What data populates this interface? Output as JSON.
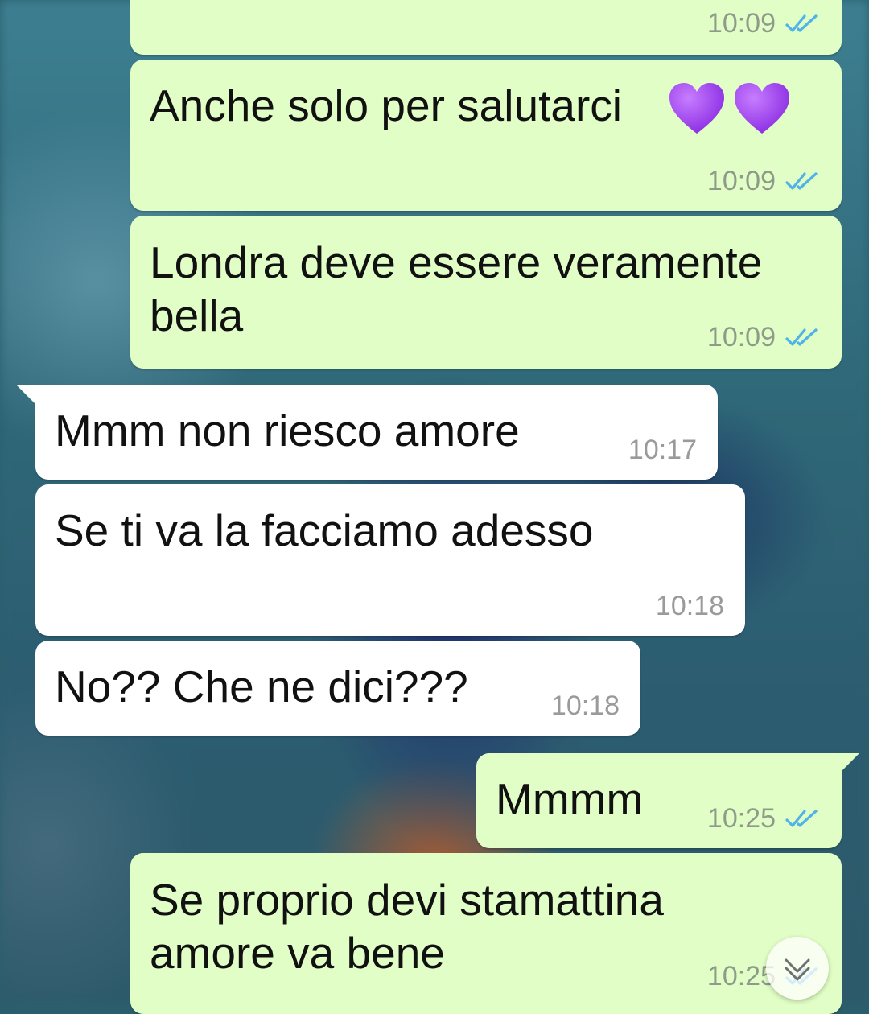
{
  "colors": {
    "outgoing_bubble": "#e1fec6",
    "incoming_bubble": "#ffffff",
    "read_ticks": "#4fb3e8",
    "timestamp": "#8f9a8a"
  },
  "messages": [
    {
      "direction": "outgoing",
      "text": "",
      "time": "10:09",
      "status_icon": "double-check-read-icon"
    },
    {
      "direction": "outgoing",
      "text": "Anche solo per salutarci",
      "emoji": [
        "purple-heart-icon",
        "purple-heart-icon"
      ],
      "time": "10:09",
      "status_icon": "double-check-read-icon"
    },
    {
      "direction": "outgoing",
      "text_line1": "Londra deve essere veramente",
      "text_line2": "bella",
      "time": "10:09",
      "status_icon": "double-check-read-icon"
    },
    {
      "direction": "incoming",
      "text": "Mmm non riesco amore",
      "time": "10:17"
    },
    {
      "direction": "incoming",
      "text": "Se ti va la facciamo adesso",
      "time": "10:18"
    },
    {
      "direction": "incoming",
      "text": "No?? Che ne dici???",
      "time": "10:18"
    },
    {
      "direction": "outgoing",
      "text": "Mmmm",
      "time": "10:25",
      "status_icon": "double-check-read-icon"
    },
    {
      "direction": "outgoing",
      "text_line1": "Se proprio devi stamattina",
      "text_line2": "amore va bene",
      "time": "10:25",
      "status_icon": "double-check-read-icon"
    }
  ],
  "scroll_to_bottom": {
    "icon": "chevron-down-icon"
  }
}
